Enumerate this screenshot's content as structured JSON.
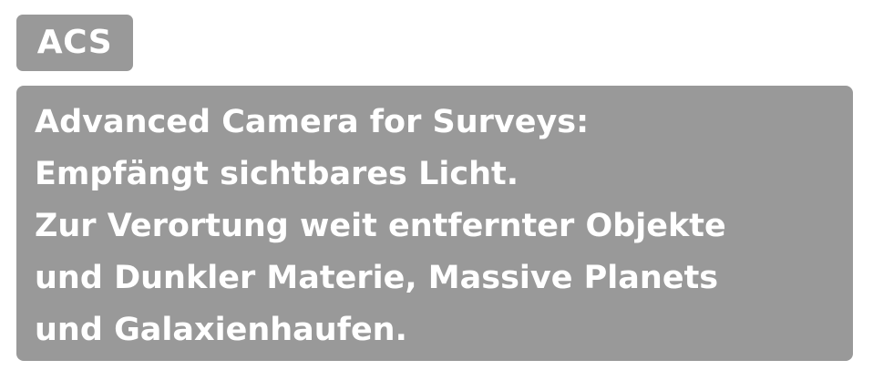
{
  "tag": {
    "label": "ACS"
  },
  "description": {
    "lines": [
      "Advanced Camera for Surveys:",
      "Empfängt sichtbares Licht.",
      "Zur Verortung weit entfernter Objekte",
      "und Dunkler Materie, Massive Planets",
      "und Galaxienhaufen."
    ]
  },
  "colors": {
    "box_background": "#999999",
    "text": "#ffffff",
    "page_background": "#ffffff"
  }
}
